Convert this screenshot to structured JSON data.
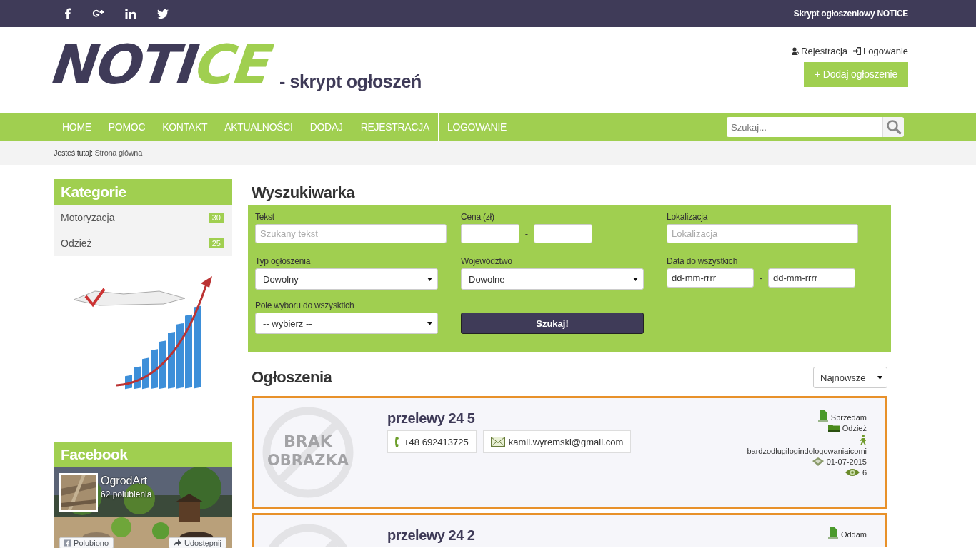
{
  "top_bar": {
    "social": [
      {
        "kind": "facebook"
      },
      {
        "kind": "google"
      },
      {
        "kind": "linkedin"
      },
      {
        "kind": "twitter"
      }
    ],
    "site_name": "Skrypt ogłoszeniowy NOTICE"
  },
  "header": {
    "logo": {
      "dark": "NOTI",
      "accent": "CE"
    },
    "tagline": "- skrypt ogłoszeń",
    "links": [
      {
        "kind": "register",
        "label": "Rejestracja"
      },
      {
        "kind": "login",
        "label": "Logowanie"
      }
    ],
    "add_button": "+ Dodaj ogłoszenie"
  },
  "nav": {
    "items": [
      {
        "label": "HOME",
        "divider_before": false
      },
      {
        "label": "POMOC",
        "divider_before": false
      },
      {
        "label": "KONTAKT",
        "divider_before": false
      },
      {
        "label": "AKTUALNOŚCI",
        "divider_before": false
      },
      {
        "label": "DODAJ",
        "divider_before": false
      },
      {
        "label": "REJESTRACJA",
        "divider_before": true
      },
      {
        "label": "LOGOWANIE",
        "divider_before": true
      }
    ],
    "search": {
      "placeholder": "Szukaj..."
    }
  },
  "breadcrumb": {
    "label": "Jesteś tutaj:",
    "current": "Strona główna"
  },
  "sidebar": {
    "categories_title": "Kategorie",
    "categories": [
      {
        "name": "Motoryzacja",
        "count": "30"
      },
      {
        "name": "Odzież",
        "count": "25"
      }
    ],
    "facebook_title": "Facebook",
    "facebook": {
      "page_name": "OgrodArt",
      "likes": "62 polubienia",
      "like_button": "Polubiono",
      "share_button": "Udostępnij"
    }
  },
  "search": {
    "title": "Wyszukiwarka",
    "fields": [
      {
        "kind": "input",
        "label": "Tekst",
        "placeholder": "Szukany tekst"
      },
      {
        "kind": "range",
        "label": "Cena (zł)",
        "separator": "-"
      },
      {
        "kind": "input",
        "label": "Lokalizacja",
        "placeholder": "Lokalizacja"
      },
      {
        "kind": "select",
        "label": "Typ ogłoszenia",
        "value": "Dowolny"
      },
      {
        "kind": "select",
        "label": "Województwo",
        "value": "Dowolne"
      },
      {
        "kind": "dates",
        "label": "Data do wszystkich",
        "placeholders": [
          "dd-mm-rrrr",
          "dd-mm-rrrr"
        ],
        "separator": "-"
      },
      {
        "kind": "select",
        "label": "Pole wyboru do wszysktich",
        "value": "-- wybierz --"
      },
      {
        "kind": "button",
        "label": "Szukaj!"
      }
    ]
  },
  "listings": {
    "title": "Ogłoszenia",
    "sort": "Najnowsze",
    "items": [
      {
        "title": "przelewy 24 5",
        "image_text": [
          "BRAK",
          "OBRAZKA"
        ],
        "phone": "+48 692413725",
        "email": "kamil.wyremski@gmail.com",
        "type": "Sprzedam",
        "category": "Odzież",
        "user": "bardzodlugilogindologowaniaicomi",
        "date": "01-07-2015",
        "views": "6"
      },
      {
        "title": "przelewy 24 2",
        "type": "Oddam"
      }
    ]
  }
}
